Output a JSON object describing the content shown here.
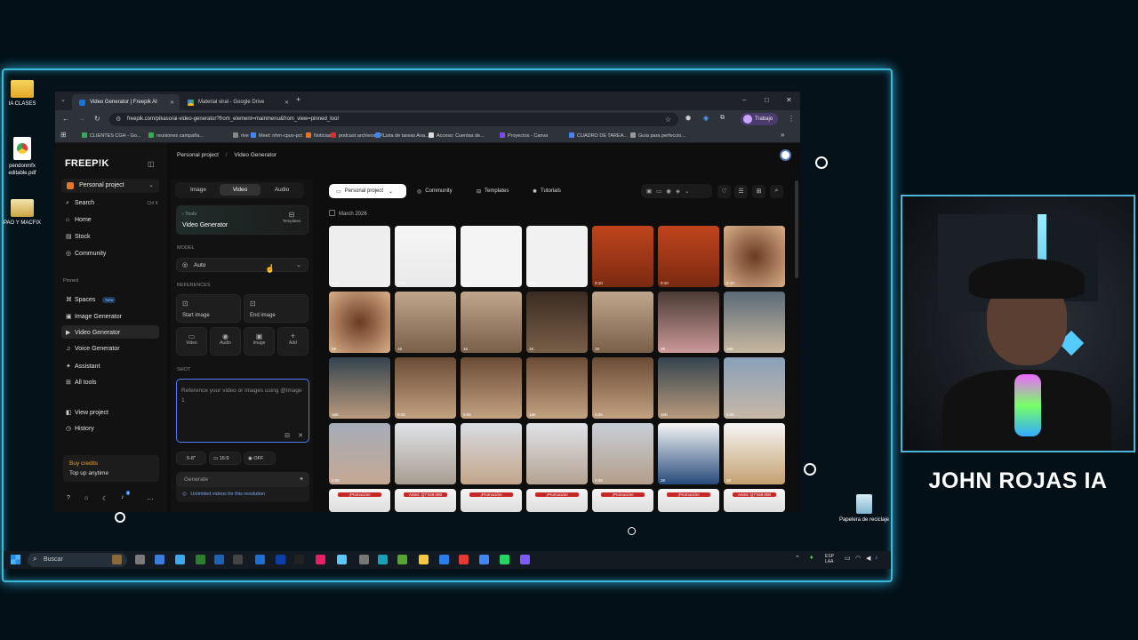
{
  "desktop": {
    "icons": [
      {
        "label": "IA CLASES"
      },
      {
        "label": "pendonmfx editable.pdf"
      },
      {
        "label": "PAO Y MACFIX"
      }
    ],
    "recycle_bin": "Papelera de reciclaje"
  },
  "browser": {
    "tabs": [
      {
        "title": "Video Generator | Freepik AI"
      },
      {
        "title": "Material viral - Google Drive"
      }
    ],
    "url": "freepik.com/pikaso/ai-video-generator?from_element=mainmenu&from_view=pinned_tool",
    "profile": "Trabajo",
    "bookmarks": [
      "CLIENTES CGH - Go...",
      "reuniones campaña...",
      "rive",
      "Meet: nhm-cpuo-pct",
      "Noticias",
      "podcast archivos - P...",
      "Lista de tareas Ana...",
      "Acceso: Cuentas de...",
      "Proyectos - Canva",
      "CUADRO DE TAREA...",
      "Guía para perfeccio..."
    ]
  },
  "sidebar": {
    "logo": "FREEP!K",
    "project": "Personal project",
    "search": "Search",
    "search_shortcut": "Ctrl K",
    "items": [
      {
        "label": "Home",
        "icon": "home-icon"
      },
      {
        "label": "Stock",
        "icon": "stock-icon"
      },
      {
        "label": "Community",
        "icon": "community-icon"
      }
    ],
    "pinned_label": "Pinned",
    "pinned": [
      {
        "label": "Spaces",
        "badge": "New"
      },
      {
        "label": "Image Generator"
      },
      {
        "label": "Video Generator"
      },
      {
        "label": "Voice Generator"
      },
      {
        "label": "Assistant"
      },
      {
        "label": "All tools"
      }
    ],
    "view_project": "View project",
    "history": "History",
    "buy_credits": "Buy credits",
    "top_up": "Top up anytime",
    "notif_count": "9"
  },
  "header": {
    "breadcrumb_root": "Personal project",
    "breadcrumb_sep": "/",
    "breadcrumb_current": "Video Generator"
  },
  "generator": {
    "tabs": [
      "Image",
      "Video",
      "Audio"
    ],
    "tools_back": "Tools",
    "tool_title": "Video Generator",
    "templates": "Templates",
    "model_label": "MODEL",
    "model_value": "Auto",
    "references_label": "REFERENCES",
    "start_image": "Start image",
    "end_image": "End image",
    "ref_types": [
      "Video",
      "Audio",
      "Image",
      "Add"
    ],
    "shot_label": "SHOT",
    "prompt_placeholder": "Reference your video or images using @image 1",
    "duration": "5-8\"",
    "ratio": "16:9",
    "audio_toggle": "OFF",
    "generate": "Generate",
    "unlimited_note": "Unlimited videos for this resolution"
  },
  "content": {
    "filter_project": "Personal project",
    "community": "Community",
    "templates": "Templates",
    "tutorials": "Tutorials",
    "month": "March 2026",
    "rows": [
      [
        {
          "meta": "0:10"
        },
        {
          "meta": "0:05"
        },
        {
          "meta": "0:05"
        },
        {
          "meta": "0:10"
        },
        {
          "meta": "0:10"
        },
        {
          "meta": "0:10"
        },
        {
          "meta": "0:10"
        }
      ],
      [
        {
          "meta": "2K"
        },
        {
          "meta": "1K"
        },
        {
          "meta": "1K"
        },
        {
          "meta": "1K"
        },
        {
          "meta": "1K"
        },
        {
          "meta": "2K"
        },
        {
          "meta": "16K"
        }
      ],
      [
        {
          "meta": "16K"
        },
        {
          "meta": "0:05"
        },
        {
          "meta": "0:05"
        },
        {
          "meta": "16K"
        },
        {
          "meta": "0:05"
        },
        {
          "meta": "16K"
        },
        {
          "meta": "0:08"
        }
      ],
      [
        {
          "meta": "0:08"
        },
        {
          "meta": ""
        },
        {
          "meta": ""
        },
        {
          "meta": ""
        },
        {
          "meta": "0:08"
        },
        {
          "meta": "2K"
        },
        {
          "meta": "2K"
        }
      ]
    ],
    "row5_texts": [
      "¡Promoción!",
      "Antes: Q7'449.000",
      "¡Promoción!",
      "¡Promoción!",
      "¡Promoción!",
      "¡Promoción!",
      "Antes: Q7'449.000"
    ]
  },
  "taskbar": {
    "search": "Buscar",
    "lang": "ESP LAA"
  },
  "overlay": {
    "streamer_name": "JOHN ROJAS IA"
  }
}
